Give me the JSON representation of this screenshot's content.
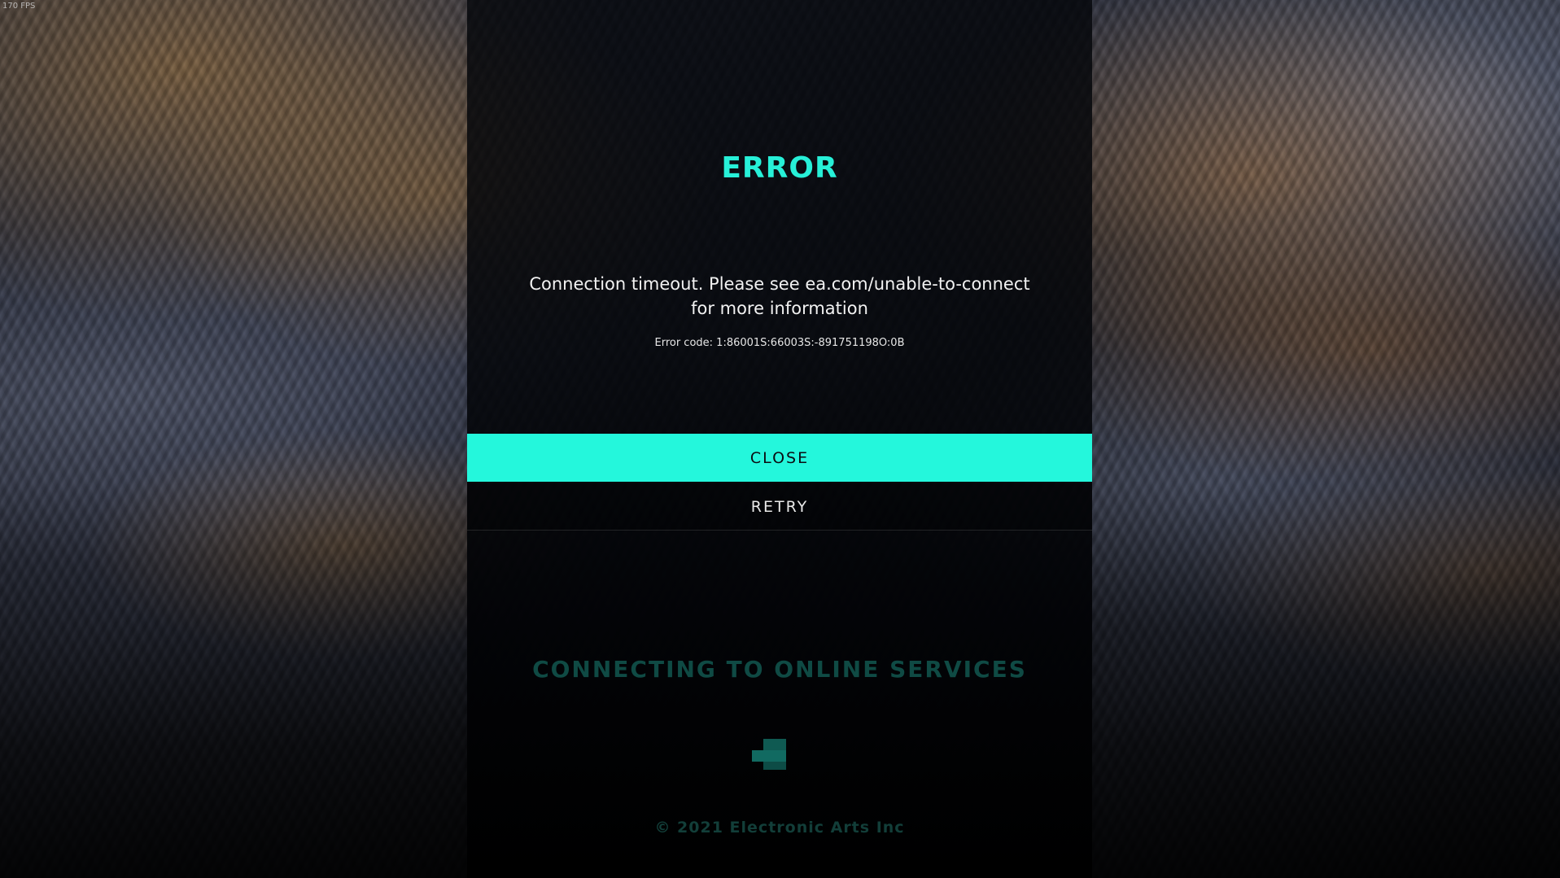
{
  "hud": {
    "fps": "170 FPS"
  },
  "dialog": {
    "title": "ERROR",
    "message_line1": "Connection timeout. Please see ea.com/unable-to-connect",
    "message_line2": "for more information",
    "error_code": "Error code: 1:86001S:66003S:-891751198O:0B",
    "buttons": {
      "close_label": "CLOSE",
      "retry_label": "RETRY"
    }
  },
  "background_status": {
    "connecting_label": "CONNECTING TO ONLINE SERVICES",
    "loading_icon": "loading-blocks-icon",
    "copyright": "© 2021 Electronic Arts Inc"
  },
  "colors": {
    "accent": "#24f7dc",
    "title": "#27f0d8",
    "dim_accent": "#0f4a44"
  }
}
